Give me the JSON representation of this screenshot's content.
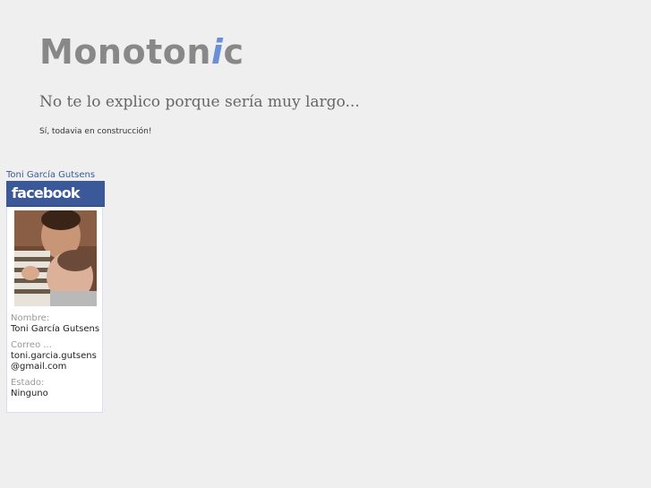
{
  "header": {
    "logo_main": "Monoton",
    "logo_accent": "i",
    "logo_end": "c",
    "tagline": "No te lo explico porque sería muy largo...",
    "status_note": "Sí, todavia en construcción!"
  },
  "badge": {
    "name_link": "Toni García Gutsens",
    "brand": "facebook",
    "photo_icon": "profile-photo",
    "fields": [
      {
        "label": "Nombre:",
        "value": "Toni García Gutsens"
      },
      {
        "label": "Correo ...",
        "value": "toni.garcia.gutsens@gmail.com"
      },
      {
        "label": "Estado:",
        "value": "Ninguno"
      }
    ]
  },
  "colors": {
    "background": "#efefef",
    "logo_gray": "#888888",
    "logo_accent": "#6b8fd6",
    "facebook_blue": "#3b5998"
  }
}
